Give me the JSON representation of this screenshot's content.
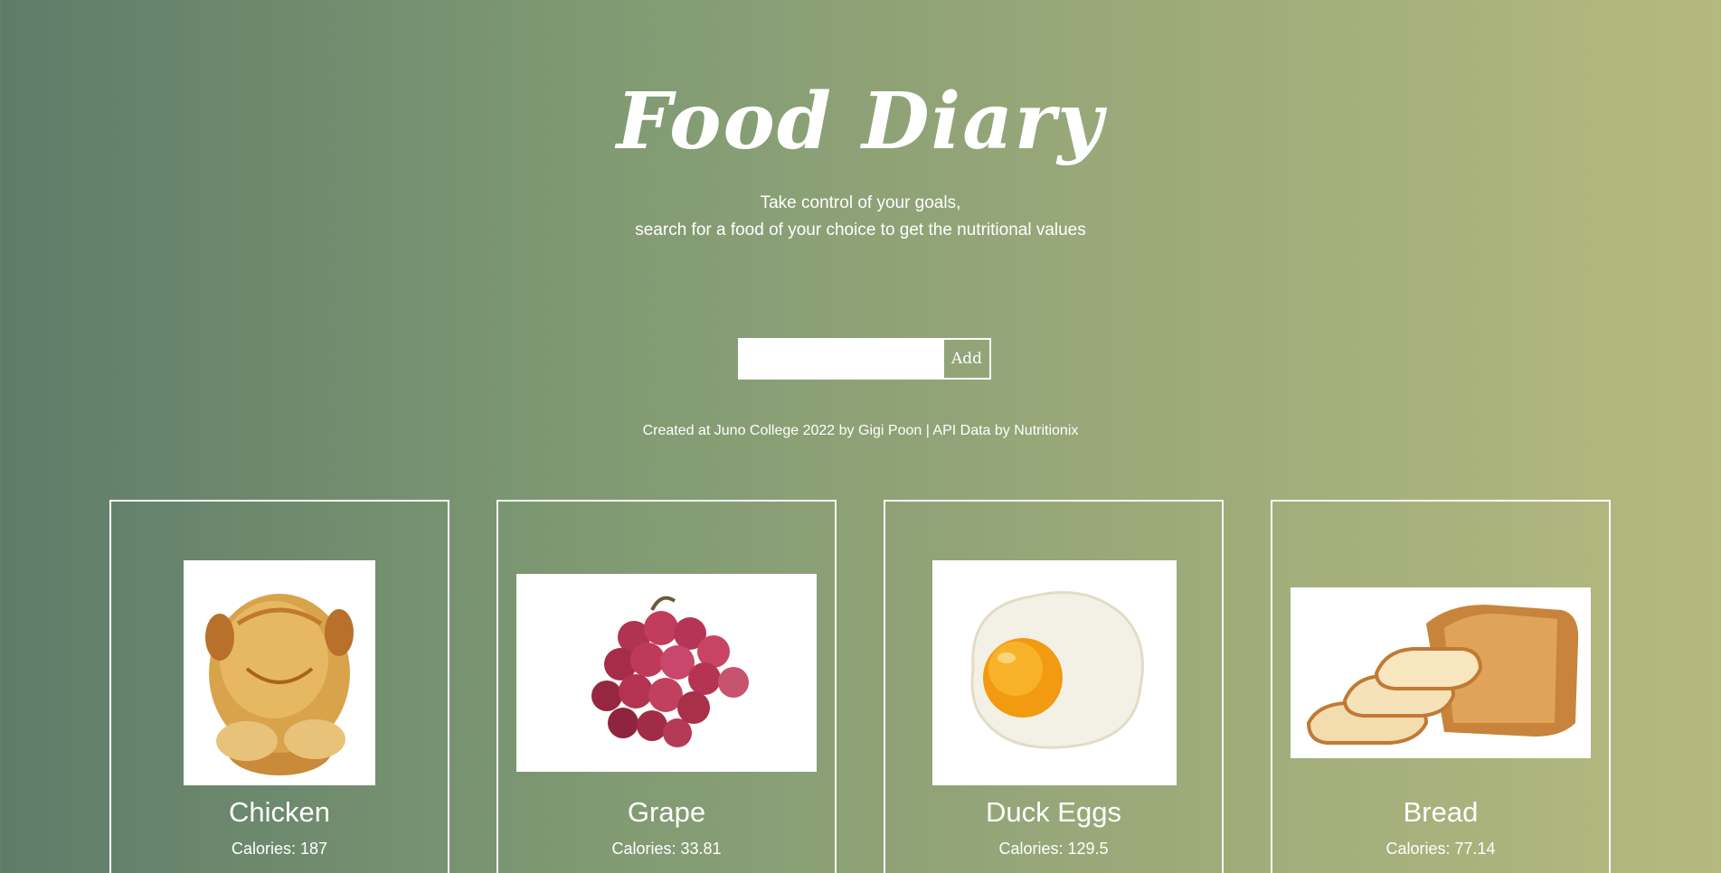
{
  "header": {
    "title": "Food Diary",
    "subtitle_line1": "Take control of your goals,",
    "subtitle_line2": "search for a food of your choice to get the nutritional values"
  },
  "search": {
    "value": "",
    "placeholder": "",
    "add_label": "Add"
  },
  "credit": "Created at Juno College 2022 by Gigi Poon | API Data by Nutritionix",
  "cards": [
    {
      "name": "Chicken",
      "calories_label": "Calories: ",
      "calories_value": "187",
      "image": "roast-chicken"
    },
    {
      "name": "Grape",
      "calories_label": "Calories: ",
      "calories_value": "33.81",
      "image": "red-grapes"
    },
    {
      "name": "Duck Eggs",
      "calories_label": "Calories: ",
      "calories_value": "129.5",
      "image": "fried-egg"
    },
    {
      "name": "Bread",
      "calories_label": "Calories: ",
      "calories_value": "77.14",
      "image": "sliced-bread"
    }
  ],
  "colors": {
    "gradient_start": "#5e7c69",
    "gradient_end": "#b5b97f",
    "text": "#ffffff"
  }
}
